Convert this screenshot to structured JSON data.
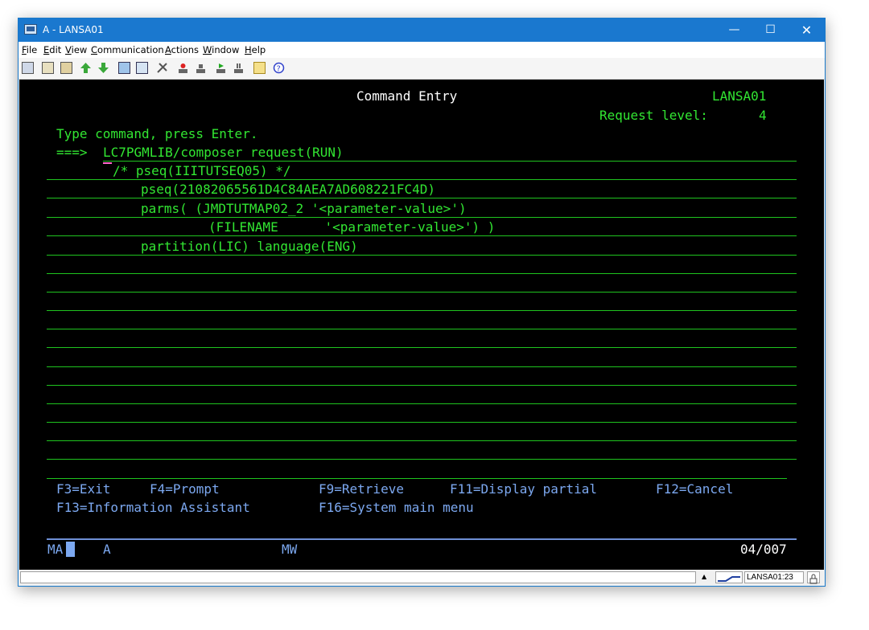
{
  "window": {
    "title": "A - LANSA01",
    "minimize_glyph": "—",
    "maximize_glyph": "☐",
    "close_glyph": "✕"
  },
  "menu": [
    {
      "underline": "F",
      "rest": "ile"
    },
    {
      "underline": "E",
      "rest": "dit"
    },
    {
      "underline": "V",
      "rest": "iew"
    },
    {
      "underline": "C",
      "rest": "ommunication"
    },
    {
      "underline": "A",
      "rest": "ctions"
    },
    {
      "underline": "W",
      "rest": "indow"
    },
    {
      "underline": "H",
      "rest": "elp"
    }
  ],
  "toolbar_icons": [
    "copy-icon",
    "paste-icon",
    "paste-special-icon",
    "send-file-icon",
    "receive-file-icon",
    "macro-icon",
    "keypad-icon",
    "settings-icon",
    "record-icon",
    "stop-icon",
    "play-icon",
    "pause-icon",
    "notes-icon",
    "help-icon"
  ],
  "terminal": {
    "screen_title": "Command Entry",
    "system_name": "LANSA01",
    "request_level_label": "Request level:",
    "request_level_value": "4",
    "instruction": "Type command, press Enter.",
    "prompt": "===>",
    "lines": [
      "LC7PGMLIB/composer request(RUN)",
      "/* pseq(IIITUTSEQ05) */",
      "pseq(21082065561D4C84AEA7AD608221FC4D)",
      "parms( (JMDTUTMAP02_2 '<parameter-value>')",
      "(FILENAME      '<parameter-value>') )",
      "partition(LIC) language(ENG)"
    ],
    "function_keys": {
      "f3": "F3=Exit",
      "f4": "F4=Prompt",
      "f9": "F9=Retrieve",
      "f11": "F11=Display partial",
      "f12": "F12=Cancel",
      "f13": "F13=Information Assistant",
      "f16": "F16=System main menu"
    },
    "oia": {
      "ma": "MA",
      "a": "A",
      "mw": "MW",
      "cursor_pos": "04/007"
    }
  },
  "statusbar": {
    "session": "LANSA01:23"
  },
  "colors": {
    "title_bar": "#1a78cf",
    "terminal_bg": "#000000",
    "terminal_green": "#32e632",
    "terminal_white": "#ffffff",
    "terminal_blue": "#7ca8f0"
  }
}
